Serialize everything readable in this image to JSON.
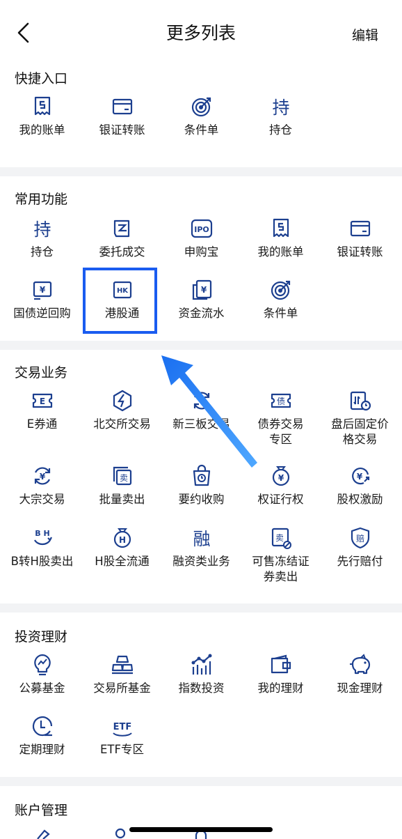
{
  "header": {
    "title": "更多列表",
    "edit_label": "编辑"
  },
  "quick": {
    "title": "快捷入口",
    "items": [
      {
        "label": "我的账单",
        "icon": "bill-icon"
      },
      {
        "label": "银证转账",
        "icon": "card-icon"
      },
      {
        "label": "条件单",
        "icon": "target-icon"
      },
      {
        "label": "持仓",
        "icon": "holding-icon",
        "glyph": "持"
      }
    ]
  },
  "common": {
    "title": "常用功能",
    "items": [
      {
        "label": "持仓",
        "icon": "holding-icon",
        "glyph": "持"
      },
      {
        "label": "委托成交",
        "icon": "order-icon"
      },
      {
        "label": "申购宝",
        "icon": "ipo-icon",
        "glyph": "IPO"
      },
      {
        "label": "我的账单",
        "icon": "bill-icon"
      },
      {
        "label": "银证转账",
        "icon": "card-icon"
      },
      {
        "label": "国债逆回购",
        "icon": "bond-repo-icon",
        "glyph": "¥"
      },
      {
        "label": "港股通",
        "icon": "hk-icon",
        "glyph": "HK"
      },
      {
        "label": "资金流水",
        "icon": "fund-flow-icon",
        "glyph": "¥"
      },
      {
        "label": "条件单",
        "icon": "target-icon"
      }
    ]
  },
  "trading": {
    "title": "交易业务",
    "items": [
      {
        "label": "E券通",
        "icon": "e-ticket-icon",
        "glyph": "E"
      },
      {
        "label": "北交所交易",
        "icon": "lightning-icon"
      },
      {
        "label": "新三板交易",
        "icon": "cycle-icon"
      },
      {
        "label": "债券交易\n专区",
        "icon": "bond-icon",
        "glyph": "债"
      },
      {
        "label": "盘后固定价\n格交易",
        "icon": "after-hours-icon"
      },
      {
        "label": "大宗交易",
        "icon": "yuan-cycle-icon",
        "glyph": "¥"
      },
      {
        "label": "批量卖出",
        "icon": "batch-sell-icon",
        "glyph": "卖"
      },
      {
        "label": "要约收购",
        "icon": "bag-clock-icon"
      },
      {
        "label": "权证行权",
        "icon": "money-bag-icon",
        "glyph": "¥"
      },
      {
        "label": "股权激励",
        "icon": "equity-incentive-icon",
        "glyph": "¥"
      },
      {
        "label": "B转H股卖出",
        "icon": "b-to-h-icon",
        "glyph": "B H"
      },
      {
        "label": "H股全流通",
        "icon": "h-bag-icon",
        "glyph": "H"
      },
      {
        "label": "融资类业务",
        "icon": "financing-icon",
        "glyph": "融"
      },
      {
        "label": "可售冻结证\n券卖出",
        "icon": "frozen-sell-icon",
        "glyph": "卖"
      },
      {
        "label": "先行赔付",
        "icon": "compensation-icon",
        "glyph": "赔"
      }
    ]
  },
  "invest": {
    "title": "投资理财",
    "items": [
      {
        "label": "公募基金",
        "icon": "bulb-chart-icon"
      },
      {
        "label": "交易所基金",
        "icon": "gold-bars-icon"
      },
      {
        "label": "指数投资",
        "icon": "index-chart-icon"
      },
      {
        "label": "我的理财",
        "icon": "wallet-icon"
      },
      {
        "label": "现金理财",
        "icon": "piggy-bank-icon"
      },
      {
        "label": "定期理财",
        "icon": "clock-icon"
      },
      {
        "label": "ETF专区",
        "icon": "etf-icon",
        "glyph": "ETF"
      }
    ]
  },
  "account": {
    "title": "账户管理"
  },
  "colors": {
    "icon": "#1c3f8f",
    "highlight": "#1a5cf0",
    "divider": "#f2f3f5",
    "arrow": "#2f8df5"
  }
}
